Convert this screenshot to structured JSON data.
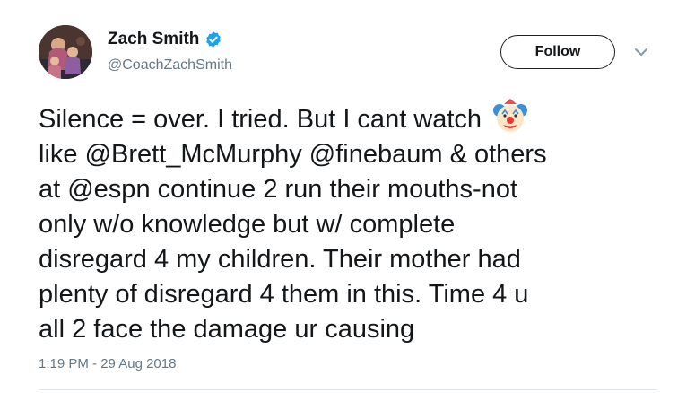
{
  "user": {
    "display_name": "Zach Smith",
    "handle": "@CoachZachSmith",
    "verified": true,
    "avatar_icon": "profile-photo"
  },
  "actions": {
    "follow_label": "Follow",
    "more_icon": "chevron-down-icon"
  },
  "tweet": {
    "line1": "Silence = over. I tried. But I cant watch ",
    "emoji": "clown-face",
    "rest": "like @Brett_McMurphy @finebaum & others\nat @espn continue 2 run their mouths-not\nonly w/o knowledge but w/ complete\ndisregard 4 my children. Their mother had\nplenty of disregard 4 them in this. Time 4 u\nall 2 face the damage ur causing",
    "timestamp": "1:19 PM - 29 Aug 2018"
  },
  "colors": {
    "text": "#14171a",
    "secondary": "#657786",
    "verified_blue": "#1da1f2",
    "divider": "#e1e8ed"
  }
}
